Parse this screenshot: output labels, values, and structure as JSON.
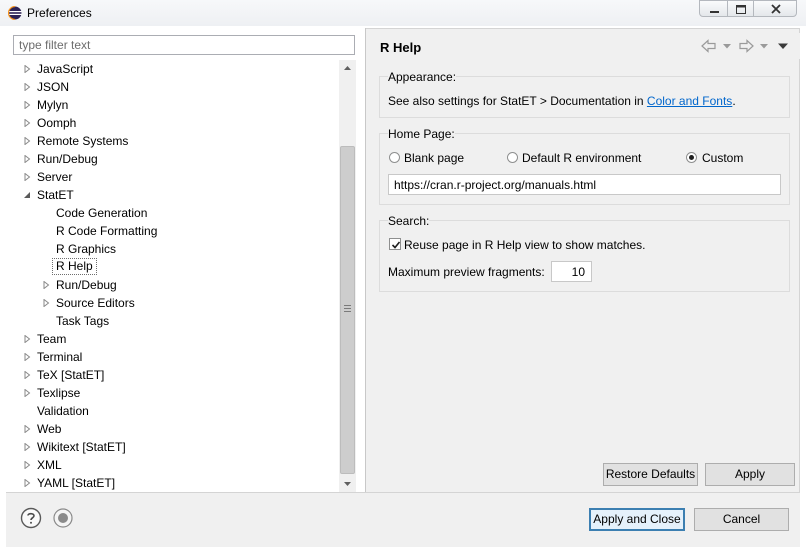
{
  "window": {
    "title": "Preferences"
  },
  "filter": {
    "placeholder": "type filter text"
  },
  "tree": [
    {
      "label": "JavaScript",
      "level": 0,
      "expander": "collapsed"
    },
    {
      "label": "JSON",
      "level": 0,
      "expander": "collapsed"
    },
    {
      "label": "Mylyn",
      "level": 0,
      "expander": "collapsed"
    },
    {
      "label": "Oomph",
      "level": 0,
      "expander": "collapsed"
    },
    {
      "label": "Remote Systems",
      "level": 0,
      "expander": "collapsed"
    },
    {
      "label": "Run/Debug",
      "level": 0,
      "expander": "collapsed"
    },
    {
      "label": "Server",
      "level": 0,
      "expander": "collapsed"
    },
    {
      "label": "StatET",
      "level": 0,
      "expander": "expanded"
    },
    {
      "label": "Code Generation",
      "level": 1,
      "expander": "none"
    },
    {
      "label": "R Code Formatting",
      "level": 1,
      "expander": "none"
    },
    {
      "label": "R Graphics",
      "level": 1,
      "expander": "none"
    },
    {
      "label": "R Help",
      "level": 1,
      "expander": "none",
      "selected": true
    },
    {
      "label": "Run/Debug",
      "level": 1,
      "expander": "collapsed"
    },
    {
      "label": "Source Editors",
      "level": 1,
      "expander": "collapsed"
    },
    {
      "label": "Task Tags",
      "level": 1,
      "expander": "none"
    },
    {
      "label": "Team",
      "level": 0,
      "expander": "collapsed"
    },
    {
      "label": "Terminal",
      "level": 0,
      "expander": "collapsed"
    },
    {
      "label": "TeX  [StatET]",
      "level": 0,
      "expander": "collapsed"
    },
    {
      "label": "Texlipse",
      "level": 0,
      "expander": "collapsed"
    },
    {
      "label": "Validation",
      "level": 0,
      "expander": "none"
    },
    {
      "label": "Web",
      "level": 0,
      "expander": "collapsed"
    },
    {
      "label": "Wikitext  [StatET]",
      "level": 0,
      "expander": "collapsed"
    },
    {
      "label": "XML",
      "level": 0,
      "expander": "collapsed"
    },
    {
      "label": "YAML  [StatET]",
      "level": 0,
      "expander": "collapsed"
    }
  ],
  "page": {
    "title": "R Help",
    "appearance": {
      "label": "Appearance:",
      "text": "See also settings for StatET > Documentation in ",
      "link": "Color and Fonts",
      "suffix": "."
    },
    "home_page": {
      "label": "Home Page:",
      "options": [
        "Blank page",
        "Default R environment",
        "Custom"
      ],
      "selected": "Custom",
      "url": "https://cran.r-project.org/manuals.html"
    },
    "search": {
      "label": "Search:",
      "reuse_label": "Reuse page in R Help view to show matches.",
      "reuse_checked": true,
      "max_fragments_label": "Maximum preview fragments:",
      "max_fragments_value": "10"
    },
    "restore_defaults": "Restore Defaults",
    "apply": "Apply"
  },
  "footer": {
    "apply_and_close": "Apply and Close",
    "cancel": "Cancel"
  },
  "icons": {
    "expander_collapsed": "triangle-right-icon",
    "expander_expanded": "triangle-down-icon",
    "back": "back-arrow-icon",
    "forward": "forward-arrow-icon",
    "menu": "view-menu-icon",
    "help": "help-icon",
    "record": "record-macro-icon"
  },
  "colors": {
    "link": "#0066cc",
    "selection_border": "#6e6e6e",
    "default_button": "#3c7fb1"
  }
}
